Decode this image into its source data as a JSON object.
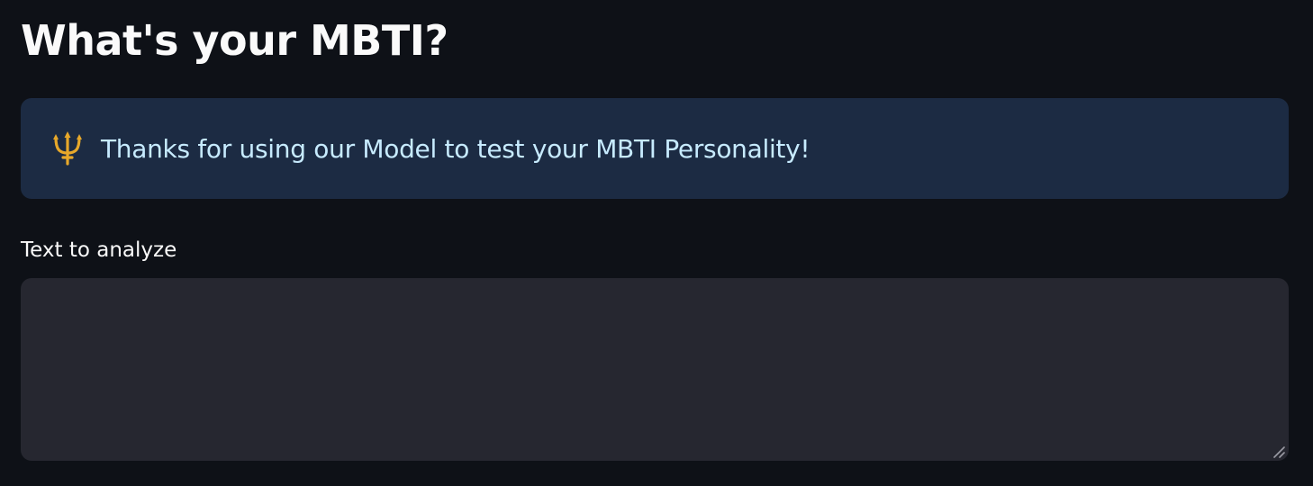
{
  "header": {
    "title": "What's your MBTI?"
  },
  "info_alert": {
    "icon": "trident-icon",
    "message": "Thanks for using our Model to test your MBTI Personality!"
  },
  "input": {
    "label": "Text to analyze",
    "value": "",
    "placeholder": ""
  },
  "colors": {
    "background": "#0e1117",
    "alert_background": "#1c2b43",
    "alert_text": "#c7ebff",
    "input_background": "#262730",
    "text": "#fafafa",
    "icon_gold": "#e7a82a"
  }
}
